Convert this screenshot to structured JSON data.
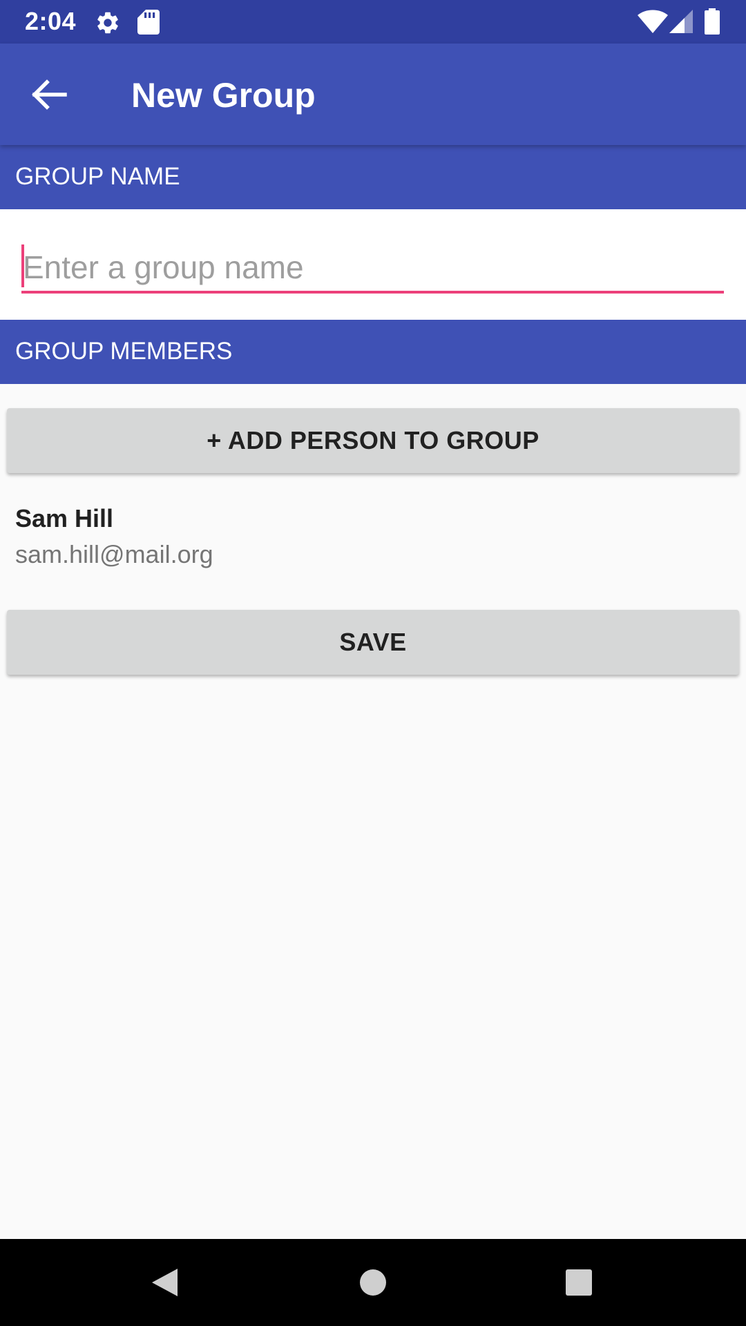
{
  "status_bar": {
    "time": "2:04",
    "icons": [
      "settings-icon",
      "sd-card-icon",
      "wifi-icon",
      "cell-signal-icon",
      "battery-icon"
    ]
  },
  "app_bar": {
    "title": "New Group",
    "back_icon": "arrow-back-icon"
  },
  "group_name_section": {
    "header": "GROUP NAME",
    "input_value": "",
    "input_placeholder": "Enter a group name"
  },
  "group_members_section": {
    "header": "GROUP MEMBERS",
    "add_button_label": "+ ADD PERSON TO GROUP",
    "members": [
      {
        "name": "Sam Hill",
        "email": "sam.hill@mail.org"
      }
    ]
  },
  "save_button_label": "SAVE",
  "nav_bar": {
    "icons": [
      "back-triangle-icon",
      "home-circle-icon",
      "recents-square-icon"
    ]
  },
  "colors": {
    "primary": "#3f51b5",
    "primary_dark": "#303f9f",
    "accent": "#ec407a",
    "button_bg": "#d6d7d7",
    "background": "#fafafa"
  }
}
